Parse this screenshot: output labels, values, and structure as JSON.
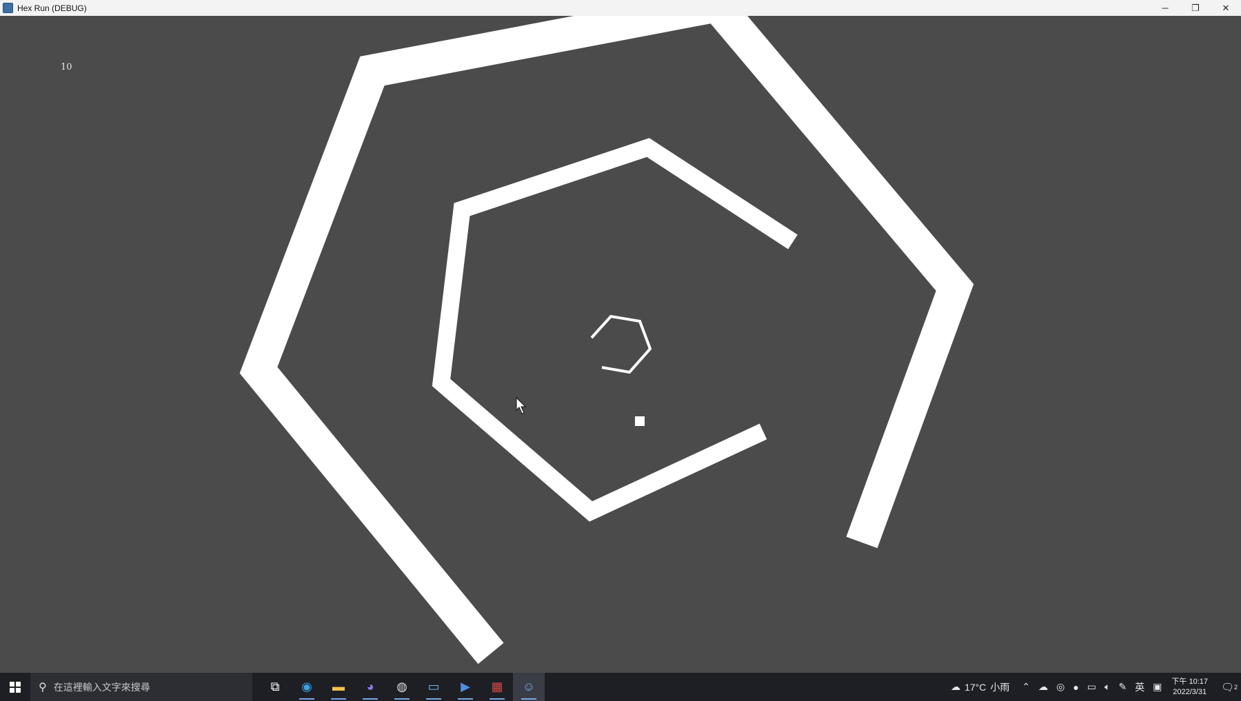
{
  "window": {
    "title": "Hex Run (DEBUG)",
    "minimize_glyph": "─",
    "maximize_glyph": "❐",
    "close_glyph": "✕"
  },
  "game": {
    "score": "10",
    "background_color": "#4b4b4b",
    "wall_color": "#ffffff"
  },
  "taskbar": {
    "search_placeholder": "在這裡輸入文字來搜尋",
    "apps": [
      {
        "name": "task-view",
        "icon": "task-view-icon",
        "glyph": "⧉"
      },
      {
        "name": "edge",
        "icon": "edge-icon",
        "glyph": "◉"
      },
      {
        "name": "file-explorer",
        "icon": "folder-icon",
        "glyph": "▬"
      },
      {
        "name": "discord",
        "icon": "discord-icon",
        "glyph": "◕"
      },
      {
        "name": "obs",
        "icon": "obs-icon",
        "glyph": "◍"
      },
      {
        "name": "remote-desktop",
        "icon": "monitor-icon",
        "glyph": "▭"
      },
      {
        "name": "media",
        "icon": "media-icon",
        "glyph": "▶"
      },
      {
        "name": "winrar",
        "icon": "archive-icon",
        "glyph": "▦"
      },
      {
        "name": "godot",
        "icon": "godot-icon",
        "glyph": "☺"
      }
    ],
    "weather": {
      "temperature": "17°C",
      "condition": "小雨"
    },
    "ime": "英",
    "clock": {
      "time": "下午 10:17",
      "date": "2022/3/31"
    },
    "notifications": "2"
  }
}
